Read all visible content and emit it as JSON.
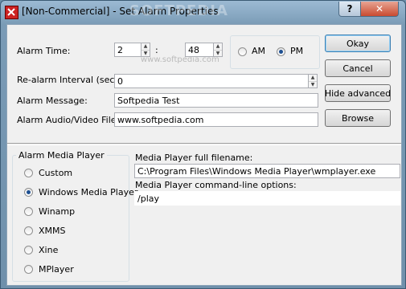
{
  "window": {
    "title": "[Non-Commercial] - Set Alarm Properties",
    "watermark": "SOFTPEDIA",
    "watermark_url": "www.softpedia.com",
    "help_label": "?",
    "close_label": "✕"
  },
  "alarm": {
    "time_label": "Alarm Time:",
    "hour": "2",
    "separator": ":",
    "minute": "48",
    "am_label": "AM",
    "pm_label": "PM",
    "selected_period": "PM",
    "realarm_label": "Re-alarm Interval (sec):",
    "realarm_value": "0",
    "message_label": "Alarm Message:",
    "message_value": "Softpedia Test",
    "audio_label": "Alarm Audio/Video File:",
    "audio_value": "www.softpedia.com"
  },
  "buttons": {
    "okay": "Okay",
    "cancel": "Cancel",
    "hide_advanced": "Hide advanced",
    "browse": "Browse"
  },
  "media_player": {
    "group_title": "Alarm Media Player",
    "options": [
      "Custom",
      "Windows Media Player",
      "Winamp",
      "XMMS",
      "Xine",
      "MPlayer"
    ],
    "selected": "Windows Media Player",
    "filename_label": "Media Player full filename:",
    "filename_value": "C:\\Program Files\\Windows Media Player\\wmplayer.exe",
    "cmdline_label": "Media Player command-line options:",
    "cmdline_value": "/play"
  },
  "colors": {
    "accent": "#3c7fb1",
    "close_button": "#c94b30",
    "title_bar": "#7a9bb6"
  }
}
